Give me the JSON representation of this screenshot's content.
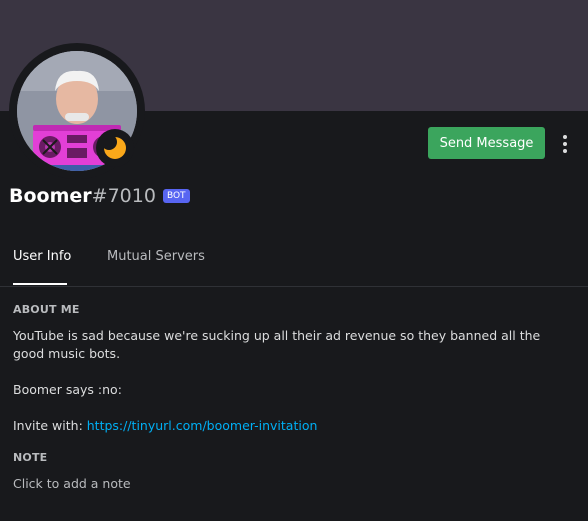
{
  "profile": {
    "username": "Boomer",
    "discriminator": "#7010",
    "bot_tag": "BOT",
    "banner_color": "#3a3542",
    "status": "idle",
    "status_color": "#faa81a"
  },
  "actions": {
    "send_message_label": "Send Message",
    "more_icon": "vertical-ellipsis-icon"
  },
  "tabs": [
    {
      "label": "User Info",
      "active": true
    },
    {
      "label": "Mutual Servers",
      "active": false
    }
  ],
  "about": {
    "heading": "ABOUT ME",
    "line1": "YouTube is sad because we're sucking up all their ad revenue so they banned all the good music bots.",
    "line2": "Boomer says :no:",
    "invite_prefix": "Invite with: ",
    "invite_link": "https://tinyurl.com/boomer-invitation"
  },
  "note": {
    "heading": "NOTE",
    "placeholder": "Click to add a note"
  }
}
